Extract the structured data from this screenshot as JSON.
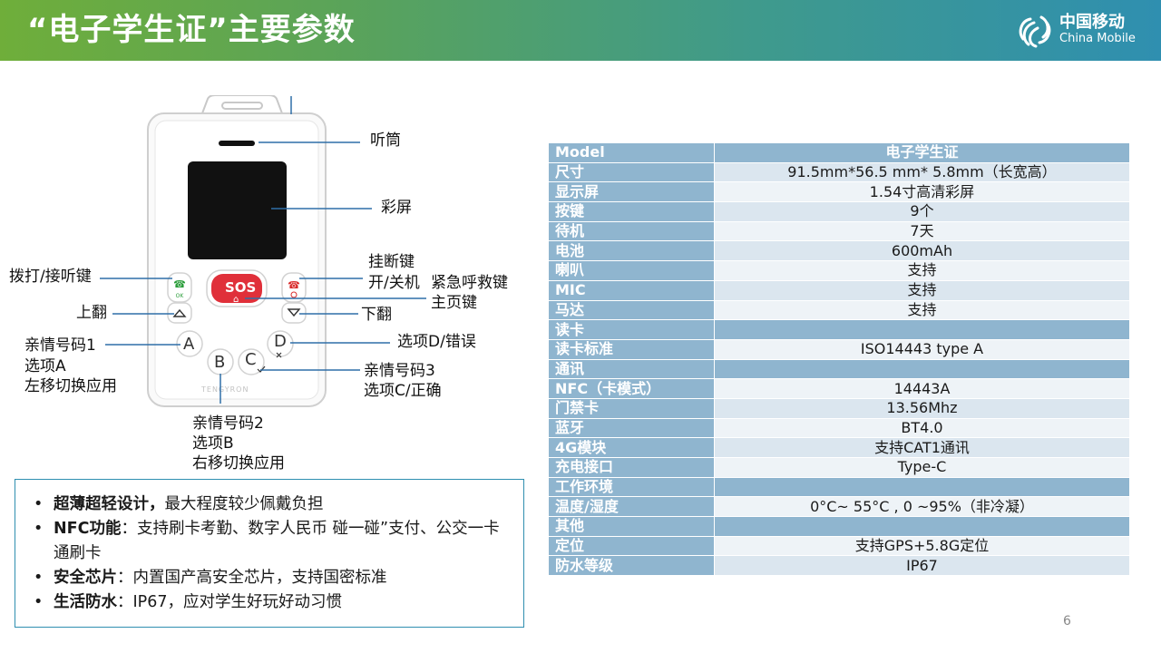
{
  "header": {
    "title": "“电子学生证”主要参数",
    "logo_cn": "中国移动",
    "logo_en": "China Mobile"
  },
  "device": {
    "sos_label": "SOS",
    "brand": "TENGYRON",
    "keys": {
      "a": "A",
      "b": "B",
      "c": "C",
      "d": "D"
    }
  },
  "labels": {
    "receiver": "听筒",
    "screen": "彩屏",
    "hangup_line1": "挂断键",
    "hangup_line2": "开/关机",
    "sos": "紧急呼救键",
    "home": "主页键",
    "call": "拨打/接听键",
    "page_up": "上翻",
    "page_down": "下翻",
    "key_a": [
      "亲情号码1",
      "选项A",
      "左移切换应用"
    ],
    "key_d": "选项D/错误",
    "key_c": [
      "亲情号码3",
      "选项C/正确"
    ],
    "key_b": [
      "亲情号码2",
      "选项B",
      "右移切换应用"
    ]
  },
  "features": [
    {
      "title": "超薄超轻设计，",
      "text": "最大程度较少佩戴负担"
    },
    {
      "title": "NFC功能",
      "text": "：支持刷卡考勤、数字人民币 碰一碰”支付、公交一卡通刷卡"
    },
    {
      "title": "安全芯片",
      "text": "：内置国产高安全芯片，支持国密标准"
    },
    {
      "title": "生活防水",
      "text": "：IP67，应对学生好玩好动习惯"
    }
  ],
  "spec_table": [
    {
      "key": "Model",
      "value": "电子学生证",
      "type": "head"
    },
    {
      "key": "尺寸",
      "value": "91.5mm*56.5 mm* 5.8mm（长宽高）"
    },
    {
      "key": "显示屏",
      "value": "1.54寸高清彩屏"
    },
    {
      "key": "按键",
      "value": "9个"
    },
    {
      "key": "待机",
      "value": "7天"
    },
    {
      "key": "电池",
      "value": "600mAh"
    },
    {
      "key": "喇叭",
      "value": "支持"
    },
    {
      "key": "MIC",
      "value": "支持"
    },
    {
      "key": "马达",
      "value": "支持"
    },
    {
      "key": "读卡",
      "value": "",
      "type": "section"
    },
    {
      "key": "读卡标准",
      "value": "ISO14443 type A"
    },
    {
      "key": "通讯",
      "value": "",
      "type": "section"
    },
    {
      "key": "NFC（卡模式）",
      "value": "14443A"
    },
    {
      "key": "门禁卡",
      "value": "13.56Mhz"
    },
    {
      "key": "蓝牙",
      "value": "BT4.0"
    },
    {
      "key": "4G模块",
      "value": "支持CAT1通讯"
    },
    {
      "key": "充电接口",
      "value": "Type-C"
    },
    {
      "key": "工作环境",
      "value": "",
      "type": "section"
    },
    {
      "key": "温度/湿度",
      "value": "0°C~ 55°C , 0 ~95%（非冷凝）"
    },
    {
      "key": "其他",
      "value": "",
      "type": "section"
    },
    {
      "key": "定位",
      "value": "支持GPS+5.8G定位"
    },
    {
      "key": "防水等级",
      "value": "IP67"
    }
  ],
  "page_number": "6",
  "colors": {
    "accent": "#2f8fb0",
    "table_header": "#8fb5cf",
    "sos": "#e0303a"
  }
}
